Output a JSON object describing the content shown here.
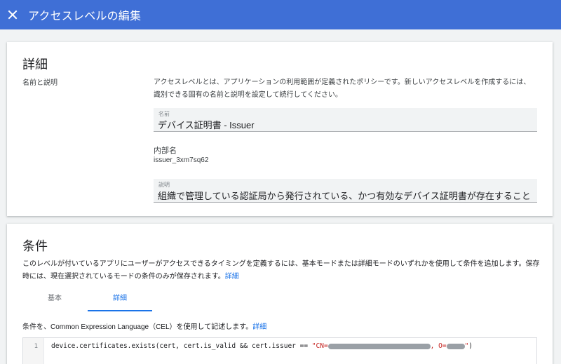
{
  "appbar": {
    "title": "アクセスレベルの編集",
    "close_icon": "close-icon",
    "color": "#3f6fd6"
  },
  "details": {
    "heading": "詳細",
    "side_label": "名前と説明",
    "description": "アクセスレベルとは、アプリケーションの利用範囲が定義されたポリシーです。新しいアクセスレベルを作成するには、識別できる固有の名前と説明を設定して続行してください。",
    "name_field": {
      "label": "名前",
      "value": "デバイス証明書 - Issuer"
    },
    "internal_name": {
      "label": "内部名",
      "value": "issuer_3xm7sq62"
    },
    "description_field": {
      "label": "説明",
      "value": "組織で管理している認証局から発行されている、かつ有効なデバイス証明書が存在すること"
    }
  },
  "conditions": {
    "heading": "条件",
    "description": "このレベルが付いているアプリにユーザーがアクセスできるタイミングを定義するには、基本モードまたは詳細モードのいずれかを使用して条件を追加します。保存時には、現在選択されているモードの条件のみが保存されます。",
    "description_link": "詳細",
    "tabs": [
      {
        "label": "基本"
      },
      {
        "label": "詳細"
      }
    ],
    "active_tab": "詳細",
    "cel_note": "条件を、Common Expression Language（CEL）を使用して記述します。",
    "cel_link": "詳細",
    "editor": {
      "line_number": "1",
      "code_prefix": "device.certificates.exists(cert, cert.is_valid && cert.issuer == ",
      "string_cn": "\"CN=",
      "string_o": ", O=",
      "string_end": "\"",
      "code_suffix": ")"
    }
  }
}
